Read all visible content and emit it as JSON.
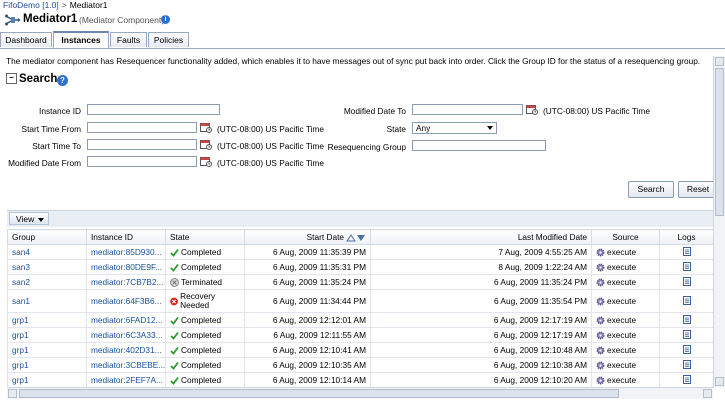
{
  "breadcrumb": {
    "root": "FifoDemo [1.0]",
    "separator": ">",
    "current": "Mediator1"
  },
  "header": {
    "title": "Mediator1",
    "subtitle": "(Mediator Component)"
  },
  "tabs": [
    {
      "label": "Dashboard"
    },
    {
      "label": "Instances"
    },
    {
      "label": "Faults"
    },
    {
      "label": "Policies"
    }
  ],
  "description": "The mediator component has Resequencer functionality added, which enables it to have messages out of sync put back into order. Click the Group ID for the status of a resequencing group.",
  "search": {
    "title": "Search",
    "instance_id_label": "Instance ID",
    "start_from_label": "Start Time From",
    "start_to_label": "Start Time To",
    "modified_from_label": "Modified Date From",
    "modified_to_label": "Modified Date To",
    "state_label": "State",
    "state_value": "Any",
    "group_label": "Resequencing Group",
    "timezone": "(UTC-08:00) US Pacific Time",
    "search_button": "Search",
    "reset_button": "Reset"
  },
  "view_menu": "View",
  "table": {
    "columns": [
      "Group",
      "Instance ID",
      "State",
      "Start Date",
      "Last Modified Date",
      "Source",
      "Logs"
    ],
    "rows": [
      {
        "group": "san4",
        "instance": "mediator:85D930...",
        "state": "Completed",
        "status": "ok",
        "start": "6 Aug, 2009 11:35:39 PM",
        "modified": "7 Aug, 2009 4:55:25 AM",
        "source": "execute"
      },
      {
        "group": "san3",
        "instance": "mediator:80DE9F...",
        "state": "Completed",
        "status": "ok",
        "start": "6 Aug, 2009 11:35:31 PM",
        "modified": "8 Aug, 2009 1:22:24 AM",
        "source": "execute"
      },
      {
        "group": "san2",
        "instance": "mediator:7CB7B2...",
        "state": "Terminated",
        "status": "terminated",
        "start": "6 Aug, 2009 11:35:24 PM",
        "modified": "6 Aug, 2009 11:35:24 PM",
        "source": "execute"
      },
      {
        "group": "san1",
        "instance": "mediator:64F3B6...",
        "state": "Recovery Needed",
        "status": "error",
        "start": "6 Aug, 2009 11:34:44 PM",
        "modified": "6 Aug, 2009 11:35:54 PM",
        "source": "execute"
      },
      {
        "group": "grp1",
        "instance": "mediator:6FAD12...",
        "state": "Completed",
        "status": "ok",
        "start": "6 Aug, 2009 12:12:01 AM",
        "modified": "6 Aug, 2009 12:17:19 AM",
        "source": "execute"
      },
      {
        "group": "grp1",
        "instance": "mediator:6C3A33...",
        "state": "Completed",
        "status": "ok",
        "start": "6 Aug, 2009 12:11:55 AM",
        "modified": "6 Aug, 2009 12:17:19 AM",
        "source": "execute"
      },
      {
        "group": "grp1",
        "instance": "mediator:402D31...",
        "state": "Completed",
        "status": "ok",
        "start": "6 Aug, 2009 12:10:41 AM",
        "modified": "6 Aug, 2009 12:10:48 AM",
        "source": "execute"
      },
      {
        "group": "grp1",
        "instance": "mediator:3CBEBE...",
        "state": "Completed",
        "status": "ok",
        "start": "6 Aug, 2009 12:10:35 AM",
        "modified": "6 Aug, 2009 12:10:38 AM",
        "source": "execute"
      },
      {
        "group": "grp1",
        "instance": "mediator:2FEF7A...",
        "state": "Completed",
        "status": "ok",
        "start": "6 Aug, 2009 12:10:14 AM",
        "modified": "6 Aug, 2009 12:10:20 AM",
        "source": "execute"
      }
    ]
  },
  "icons": {
    "ok": "check-icon",
    "terminated": "terminated-icon",
    "error": "error-icon",
    "source": "gear-icon",
    "logs": "log-document-icon",
    "calendar": "calendar-icon"
  },
  "colors": {
    "link": "#1a4f9c",
    "ok": "#2e9a2e",
    "error": "#d42a1f",
    "accent": "#2b6fd0"
  }
}
